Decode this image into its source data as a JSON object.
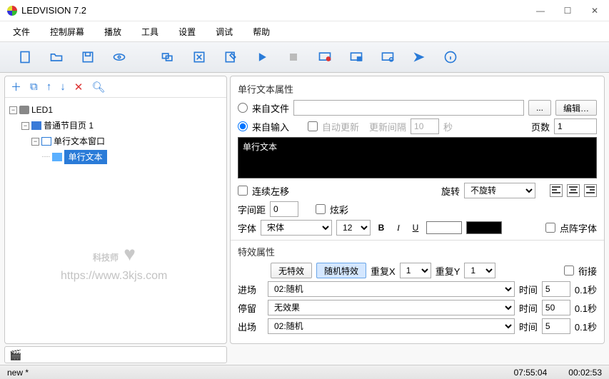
{
  "window": {
    "title": "LEDVISION 7.2"
  },
  "menu": {
    "file": "文件",
    "screen": "控制屏幕",
    "play": "播放",
    "tool": "工具",
    "setting": "设置",
    "debug": "调试",
    "help": "帮助"
  },
  "tree": {
    "root": "LED1",
    "page": "普通节目页 1",
    "win": "单行文本窗口",
    "item": "单行文本"
  },
  "attr": {
    "section_title": "单行文本属性",
    "from_file": "来自文件",
    "from_input": "来自输入",
    "browse": "...",
    "edit": "编辑…",
    "auto_update": "自动更新",
    "update_interval_label": "更新间隔",
    "update_interval_value": "10",
    "update_unit": "秒",
    "pages_label": "页数",
    "pages_value": "1",
    "text_content": "单行文本",
    "cont_left": "连续左移",
    "rotate_label": "旋转",
    "rotate_value": "不旋转",
    "spacing_label": "字间距",
    "spacing_value": "0",
    "color_effect": "炫彩",
    "font_label": "字体",
    "font_value": "宋体",
    "font_size": "12",
    "dot_font": "点阵字体"
  },
  "fx": {
    "section_title": "特效属性",
    "none": "无特效",
    "random": "随机特效",
    "repeatx_label": "重复X",
    "repeatx_value": "1",
    "repeaty_label": "重复Y",
    "repeaty_value": "1",
    "join": "衔接",
    "enter_label": "进场",
    "enter_value": "02:随机",
    "stay_label": "停留",
    "stay_value": "无效果",
    "exit_label": "出场",
    "exit_value": "02:随机",
    "time_label": "时间",
    "time_enter": "5",
    "time_stay": "50",
    "time_exit": "5",
    "time_unit": "0.1秒"
  },
  "status": {
    "left": "new *",
    "t1": "07:55:04",
    "t2": "00:02:53"
  },
  "watermark": {
    "text": "科技师",
    "url": "https://www.3kjs.com"
  }
}
